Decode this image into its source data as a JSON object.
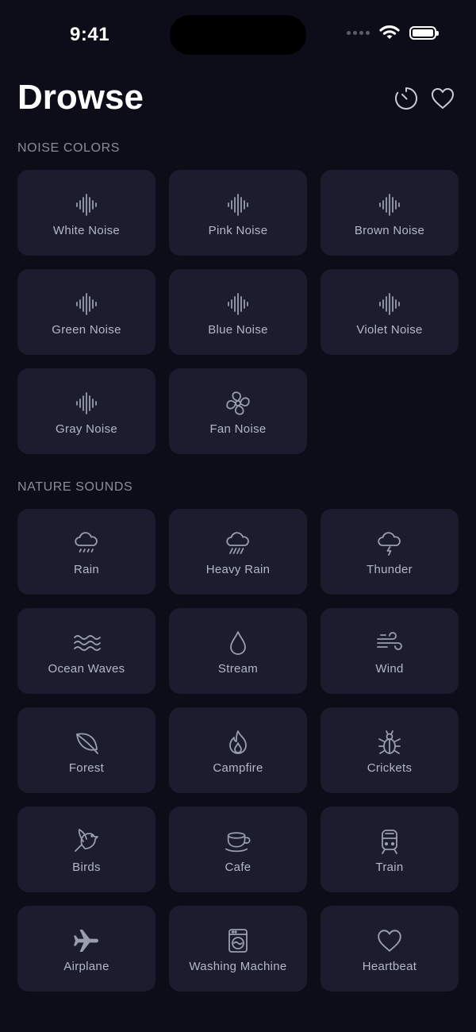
{
  "status_bar": {
    "time": "9:41"
  },
  "app": {
    "title": "Drowse"
  },
  "header": {
    "timer_icon": "timer-icon",
    "favorite_icon": "heart-icon"
  },
  "sections": {
    "noise_colors": {
      "label": "NOISE COLORS",
      "items": [
        {
          "label": "White Noise",
          "icon": "waveform-icon"
        },
        {
          "label": "Pink Noise",
          "icon": "waveform-icon"
        },
        {
          "label": "Brown Noise",
          "icon": "waveform-icon"
        },
        {
          "label": "Green Noise",
          "icon": "waveform-icon"
        },
        {
          "label": "Blue Noise",
          "icon": "waveform-icon"
        },
        {
          "label": "Violet Noise",
          "icon": "waveform-icon"
        },
        {
          "label": "Gray Noise",
          "icon": "waveform-icon"
        },
        {
          "label": "Fan Noise",
          "icon": "fan-icon"
        }
      ]
    },
    "nature_sounds": {
      "label": "NATURE SOUNDS",
      "items": [
        {
          "label": "Rain",
          "icon": "cloud-rain-icon"
        },
        {
          "label": "Heavy Rain",
          "icon": "cloud-heavy-rain-icon"
        },
        {
          "label": "Thunder",
          "icon": "cloud-bolt-icon"
        },
        {
          "label": "Ocean Waves",
          "icon": "waves-icon"
        },
        {
          "label": "Stream",
          "icon": "drop-icon"
        },
        {
          "label": "Wind",
          "icon": "wind-icon"
        },
        {
          "label": "Forest",
          "icon": "leaf-icon"
        },
        {
          "label": "Campfire",
          "icon": "flame-icon"
        },
        {
          "label": "Crickets",
          "icon": "ant-icon"
        },
        {
          "label": "Birds",
          "icon": "bird-icon"
        },
        {
          "label": "Cafe",
          "icon": "cup-icon"
        },
        {
          "label": "Train",
          "icon": "tram-icon"
        },
        {
          "label": "Airplane",
          "icon": "airplane-icon"
        },
        {
          "label": "Washing Machine",
          "icon": "washer-icon"
        },
        {
          "label": "Heartbeat",
          "icon": "heart-icon"
        }
      ]
    }
  },
  "colors": {
    "background": "#0c0d18",
    "tile": "#1b1d2e",
    "label": "#b4b7c4",
    "section_label": "#8a8d9c",
    "icon": "#9a9dac"
  }
}
